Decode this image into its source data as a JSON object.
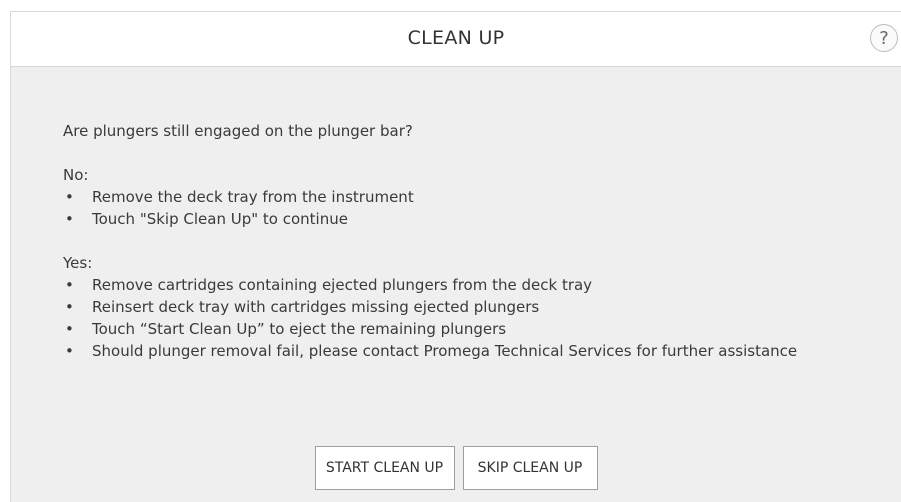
{
  "header": {
    "title": "CLEAN UP",
    "help_label": "?"
  },
  "content": {
    "question": "Are plungers still engaged on the plunger bar?",
    "no_section": {
      "label": "No:",
      "items": [
        "Remove the deck tray from the instrument",
        "Touch \"Skip Clean Up\" to continue"
      ]
    },
    "yes_section": {
      "label": "Yes:",
      "items": [
        "Remove cartridges containing ejected plungers from the deck tray",
        "Reinsert deck tray  with cartridges missing ejected plungers",
        "Touch “Start Clean Up” to eject the remaining plungers",
        "Should plunger removal fail, please contact Promega Technical Services for further assistance"
      ]
    },
    "bullet_glyph": "•"
  },
  "actions": {
    "start_label": "START CLEAN UP",
    "skip_label": "SKIP CLEAN UP"
  }
}
